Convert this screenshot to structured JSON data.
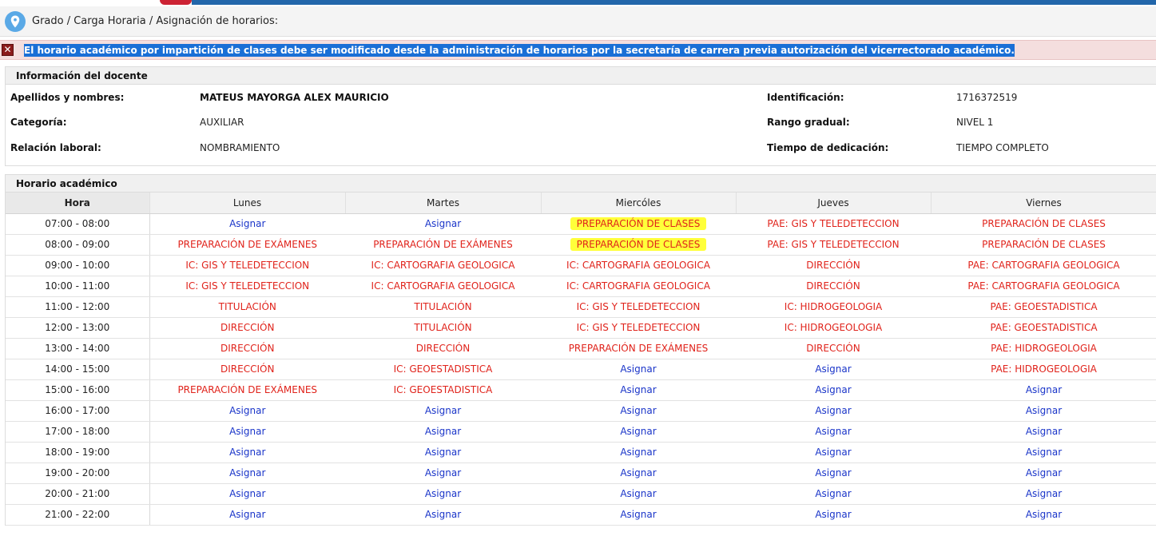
{
  "breadcrumb": "Grado / Carga Horaria / Asignación de horarios:",
  "alert": {
    "message": "El horario académico por impartición de clases debe ser modificado desde la administración de horarios por la secretaría de carrera previa autorización del vicerrectorado académico."
  },
  "docente": {
    "title": "Información del docente",
    "nombres_label": "Apellidos y nombres:",
    "nombres_value": "MATEUS MAYORGA ALEX MAURICIO",
    "id_label": "Identificación:",
    "id_value": "1716372519",
    "categoria_label": "Categoría:",
    "categoria_value": "AUXILIAR",
    "rango_label": "Rango gradual:",
    "rango_value": "NIVEL 1",
    "relacion_label": "Relación laboral:",
    "relacion_value": "NOMBRAMIENTO",
    "tiempo_label": "Tiempo de dedicación:",
    "tiempo_value": "TIEMPO COMPLETO"
  },
  "horario": {
    "title": "Horario académico",
    "headers": [
      "Hora",
      "Lunes",
      "Martes",
      "Miercóles",
      "Jueves",
      "Viernes"
    ],
    "rows": [
      {
        "hora": "07:00 - 08:00",
        "cells": [
          "Asignar",
          "Asignar",
          "PREPARACIÓN DE CLASES",
          "PAE: GIS Y TELEDETECCION",
          "PREPARACIÓN DE CLASES"
        ]
      },
      {
        "hora": "08:00 - 09:00",
        "cells": [
          "PREPARACIÓN DE EXÁMENES",
          "PREPARACIÓN DE EXÁMENES",
          "PREPARACIÓN DE CLASES",
          "PAE: GIS Y TELEDETECCION",
          "PREPARACIÓN DE CLASES"
        ]
      },
      {
        "hora": "09:00 - 10:00",
        "cells": [
          "IC: GIS Y TELEDETECCION",
          "IC: CARTOGRAFIA GEOLOGICA",
          "IC: CARTOGRAFIA GEOLOGICA",
          "DIRECCIÓN",
          "PAE: CARTOGRAFIA GEOLOGICA"
        ]
      },
      {
        "hora": "10:00 - 11:00",
        "cells": [
          "IC: GIS Y TELEDETECCION",
          "IC: CARTOGRAFIA GEOLOGICA",
          "IC: CARTOGRAFIA GEOLOGICA",
          "DIRECCIÓN",
          "PAE: CARTOGRAFIA GEOLOGICA"
        ]
      },
      {
        "hora": "11:00 - 12:00",
        "cells": [
          "TITULACIÓN",
          "TITULACIÓN",
          "IC: GIS Y TELEDETECCION",
          "IC: HIDROGEOLOGIA",
          "PAE: GEOESTADISTICA"
        ]
      },
      {
        "hora": "12:00 - 13:00",
        "cells": [
          "DIRECCIÓN",
          "TITULACIÓN",
          "IC: GIS Y TELEDETECCION",
          "IC: HIDROGEOLOGIA",
          "PAE: GEOESTADISTICA"
        ]
      },
      {
        "hora": "13:00 - 14:00",
        "cells": [
          "DIRECCIÓN",
          "DIRECCIÓN",
          "PREPARACIÓN DE EXÁMENES",
          "DIRECCIÓN",
          "PAE: HIDROGEOLOGIA"
        ]
      },
      {
        "hora": "14:00 - 15:00",
        "cells": [
          "DIRECCIÓN",
          "IC: GEOESTADISTICA",
          "Asignar",
          "Asignar",
          "PAE: HIDROGEOLOGIA"
        ]
      },
      {
        "hora": "15:00 - 16:00",
        "cells": [
          "PREPARACIÓN DE EXÁMENES",
          "IC: GEOESTADISTICA",
          "Asignar",
          "Asignar",
          "Asignar"
        ]
      },
      {
        "hora": "16:00 - 17:00",
        "cells": [
          "Asignar",
          "Asignar",
          "Asignar",
          "Asignar",
          "Asignar"
        ]
      },
      {
        "hora": "17:00 - 18:00",
        "cells": [
          "Asignar",
          "Asignar",
          "Asignar",
          "Asignar",
          "Asignar"
        ]
      },
      {
        "hora": "18:00 - 19:00",
        "cells": [
          "Asignar",
          "Asignar",
          "Asignar",
          "Asignar",
          "Asignar"
        ]
      },
      {
        "hora": "19:00 - 20:00",
        "cells": [
          "Asignar",
          "Asignar",
          "Asignar",
          "Asignar",
          "Asignar"
        ]
      },
      {
        "hora": "20:00 - 21:00",
        "cells": [
          "Asignar",
          "Asignar",
          "Asignar",
          "Asignar",
          "Asignar"
        ]
      },
      {
        "hora": "21:00 - 22:00",
        "cells": [
          "Asignar",
          "Asignar",
          "Asignar",
          "Asignar",
          "Asignar"
        ]
      }
    ],
    "highlighted": [
      [
        0,
        2
      ],
      [
        1,
        2
      ]
    ]
  },
  "colors": {
    "assigned": "#e0231b",
    "free": "#1a35c9",
    "highlight": "#ffff3a",
    "alert_bg": "#f4dede",
    "selection": "#1a6fd6"
  },
  "icons": {
    "breadcrumb": "location-pin-icon",
    "alert": "close-icon"
  }
}
